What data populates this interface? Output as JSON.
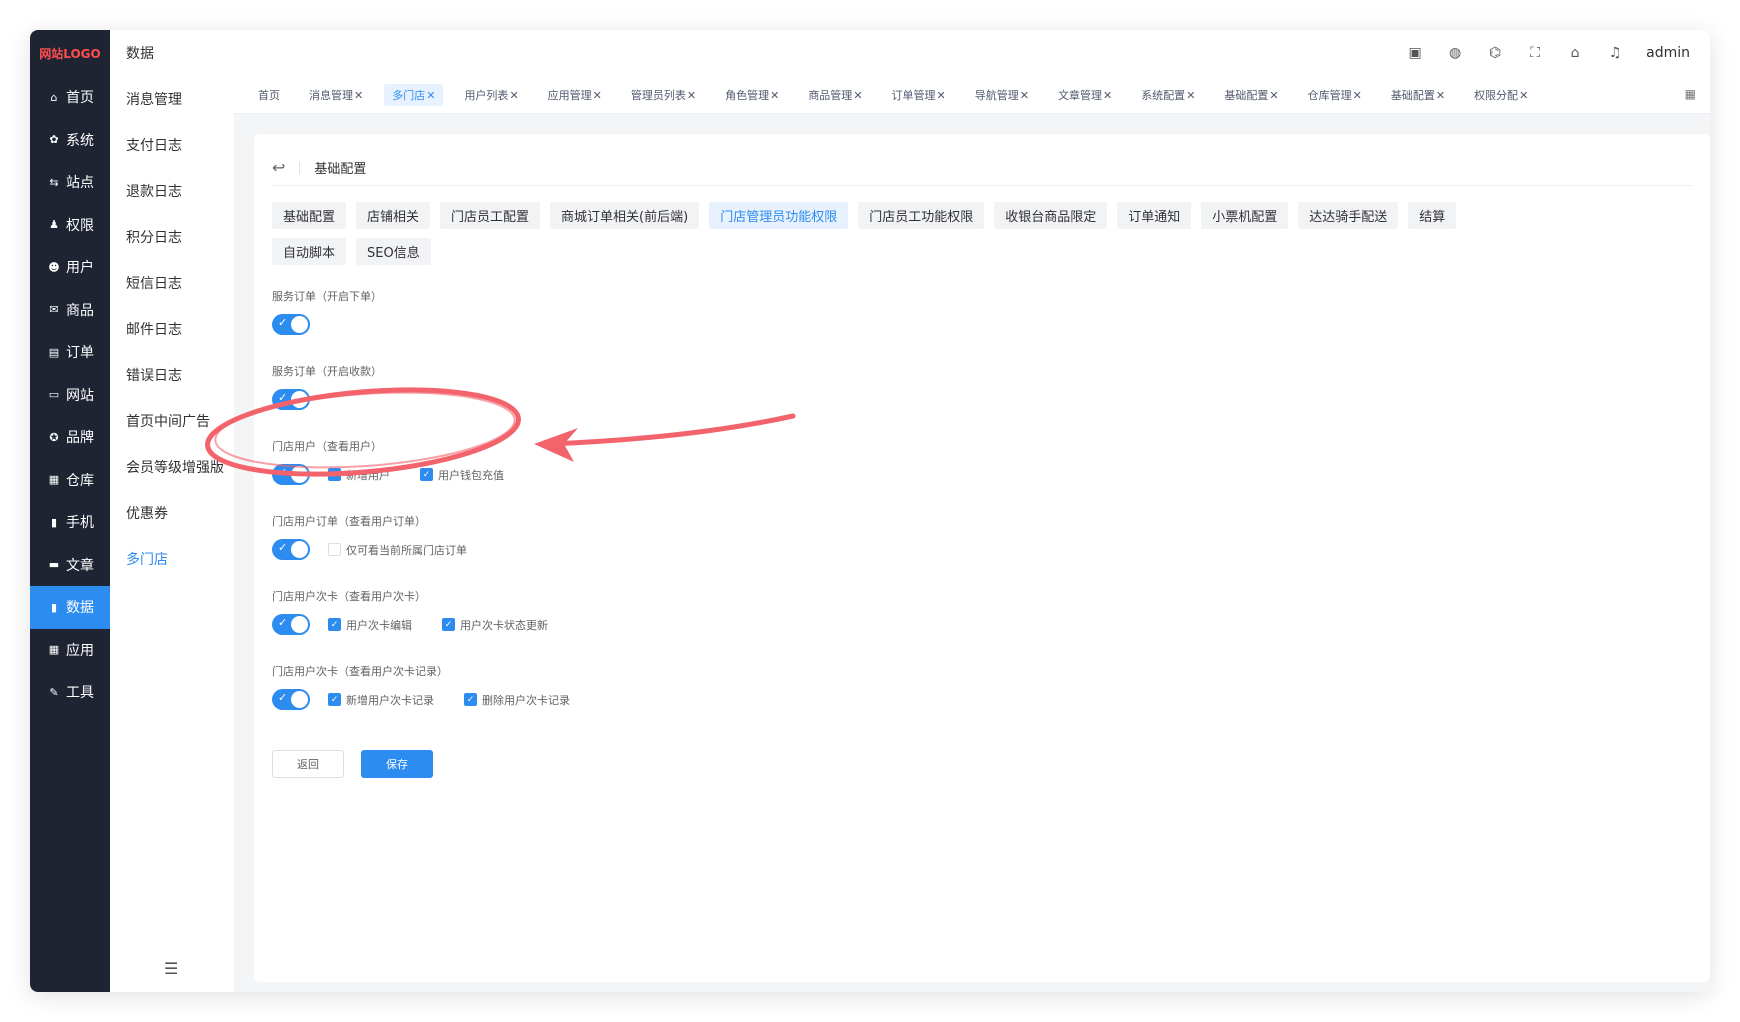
{
  "logo": "网站LOGO",
  "nav1": [
    {
      "icon": "home-icon",
      "glyph": "⌂",
      "label": "首页"
    },
    {
      "icon": "gear-icon",
      "glyph": "✿",
      "label": "系统"
    },
    {
      "icon": "site-icon",
      "glyph": "⇆",
      "label": "站点"
    },
    {
      "icon": "permission-icon",
      "glyph": "♟",
      "label": "权限"
    },
    {
      "icon": "user-icon",
      "glyph": "☻",
      "label": "用户"
    },
    {
      "icon": "goods-icon",
      "glyph": "✉",
      "label": "商品"
    },
    {
      "icon": "order-icon",
      "glyph": "▤",
      "label": "订单"
    },
    {
      "icon": "website-icon",
      "glyph": "▭",
      "label": "网站"
    },
    {
      "icon": "brand-icon",
      "glyph": "✪",
      "label": "品牌"
    },
    {
      "icon": "warehouse-icon",
      "glyph": "▦",
      "label": "仓库"
    },
    {
      "icon": "phone-icon",
      "glyph": "▮",
      "label": "手机"
    },
    {
      "icon": "article-icon",
      "glyph": "▬",
      "label": "文章"
    },
    {
      "icon": "chart-icon",
      "glyph": "▮",
      "label": "数据"
    },
    {
      "icon": "apps-icon",
      "glyph": "▦",
      "label": "应用"
    },
    {
      "icon": "wrench-icon",
      "glyph": "✎",
      "label": "工具"
    }
  ],
  "nav2": {
    "title": "数据",
    "items": [
      "消息管理",
      "支付日志",
      "退款日志",
      "积分日志",
      "短信日志",
      "邮件日志",
      "错误日志",
      "首页中间广告",
      "会员等级增强版",
      "优惠券",
      "多门店"
    ]
  },
  "header": {
    "user": "admin"
  },
  "tabs": [
    "首页",
    "消息管理",
    "多门店",
    "用户列表",
    "应用管理",
    "管理员列表",
    "角色管理",
    "商品管理",
    "订单管理",
    "导航管理",
    "文章管理",
    "系统配置",
    "基础配置",
    "仓库管理",
    "基础配置",
    "权限分配"
  ],
  "page": {
    "title": "基础配置"
  },
  "subtabs": [
    "基础配置",
    "店铺相关",
    "门店员工配置",
    "商城订单相关(前后端)",
    "门店管理员功能权限",
    "门店员工功能权限",
    "收银台商品限定",
    "订单通知",
    "小票机配置",
    "达达骑手配送",
    "结算",
    "自动脚本",
    "SEO信息"
  ],
  "sections": [
    {
      "label": "服务订单（开启下单）",
      "switch_on": true,
      "checks": []
    },
    {
      "label": "服务订单（开启收款）",
      "switch_on": true,
      "checks": []
    },
    {
      "label": "门店用户（查看用户）",
      "switch_on": true,
      "checks": [
        {
          "label": "新增用户",
          "checked": true
        },
        {
          "label": "用户钱包充值",
          "checked": true
        }
      ]
    },
    {
      "label": "门店用户订单（查看用户订单）",
      "switch_on": true,
      "checks": [
        {
          "label": "仅可看当前所属门店订单",
          "checked": false
        }
      ]
    },
    {
      "label": "门店用户次卡（查看用户次卡）",
      "switch_on": true,
      "checks": [
        {
          "label": "用户次卡编辑",
          "checked": true
        },
        {
          "label": "用户次卡状态更新",
          "checked": true
        }
      ]
    },
    {
      "label": "门店用户次卡（查看用户次卡记录）",
      "switch_on": true,
      "checks": [
        {
          "label": "新增用户次卡记录",
          "checked": true
        },
        {
          "label": "删除用户次卡记录",
          "checked": true
        }
      ]
    }
  ],
  "buttons": {
    "back": "返回",
    "save": "保存"
  },
  "colors": {
    "accent": "#2d8cf0",
    "sidebar": "#1f2432",
    "annotation": "#f2636b"
  }
}
